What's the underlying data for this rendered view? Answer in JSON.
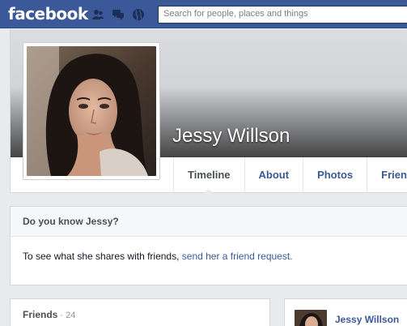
{
  "topbar": {
    "logo": "facebook",
    "search_placeholder": "Search for people, places and things"
  },
  "profile": {
    "name": "Jessy Willson",
    "tabs": [
      {
        "label": "Timeline",
        "active": true
      },
      {
        "label": "About",
        "active": false
      },
      {
        "label": "Photos",
        "active": false
      },
      {
        "label": "Frien",
        "active": false
      }
    ]
  },
  "know_box": {
    "title": "Do you know Jessy?",
    "text": "To see what she shares with friends, ",
    "link": "send her a friend request."
  },
  "friends": {
    "label": "Friends",
    "count": " · 24"
  },
  "right_panel": {
    "name": "Jessy Willson"
  },
  "colors": {
    "brand": "#3b5998",
    "background": "#e9eaed"
  }
}
